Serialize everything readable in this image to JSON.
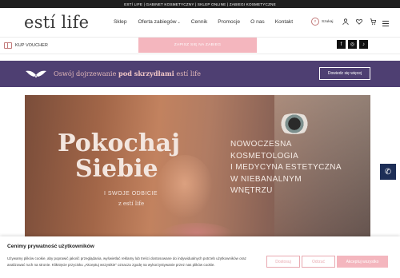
{
  "topbar": {
    "text": "ESTÍ LIFE | GABINET KOSMETYCZNY | SKLEP ONLINE | ZABIEGI KOSMETYCZNE"
  },
  "header": {
    "logo": "estí life",
    "nav": [
      {
        "label": "Sklep",
        "has_dropdown": false
      },
      {
        "label": "Oferta zabiegów",
        "has_dropdown": true
      },
      {
        "label": "Cennik",
        "has_dropdown": false
      },
      {
        "label": "Promocje",
        "has_dropdown": false
      },
      {
        "label": "O nas",
        "has_dropdown": false
      },
      {
        "label": "Kontakt",
        "has_dropdown": false
      }
    ],
    "search_label": "Szukaj",
    "icons": [
      "search-icon",
      "user-icon",
      "heart-icon",
      "cart-icon",
      "menu-icon"
    ]
  },
  "subbar": {
    "voucher_label": "KUP VOUCHER",
    "cta_label": "ZAPISZ SIĘ NA ZABIEG",
    "socials": [
      "facebook-icon",
      "instagram-icon",
      "tiktok-icon"
    ]
  },
  "promo_banner": {
    "text_part1": "Oswój dojrzewanie",
    "text_part2": "pod skrzydłami",
    "text_part3": "estí life",
    "button_label": "Dowiedz się więcej",
    "bg_color": "#4e3f72"
  },
  "hero": {
    "title_line1": "Pokochaj",
    "title_line2": "Siebie",
    "sub_line1": "I SWOJE ODBICIE",
    "sub_line2": "z estí life",
    "right_lines": [
      "NOWOCZESNA",
      "KOSMETOLOGIA",
      "I MEDYCYNA ESTETYCZNA",
      "W NIEBANALNYM",
      "WNĘTRZU"
    ]
  },
  "cookie": {
    "title": "Cenimy prywatność użytkowników",
    "text": "Używamy plików cookie, aby poprawić jakość przeglądania, wyświetlać reklamy lub treści dostosowane do indywidualnych potrzeb użytkowników oraz analizować ruch na stronie. Kliknięcie przycisku „Akceptuj wszystkie” oznacza zgodę na wykorzystywanie przez nas plików cookie.",
    "buttons": [
      "Dostosuj",
      "Odrzuć",
      "Akceptuj wszystko"
    ]
  },
  "colors": {
    "pink": "#f4b6be",
    "purple": "#4e3f72",
    "dark": "#1f1f1f",
    "navy": "#1d2e57"
  }
}
